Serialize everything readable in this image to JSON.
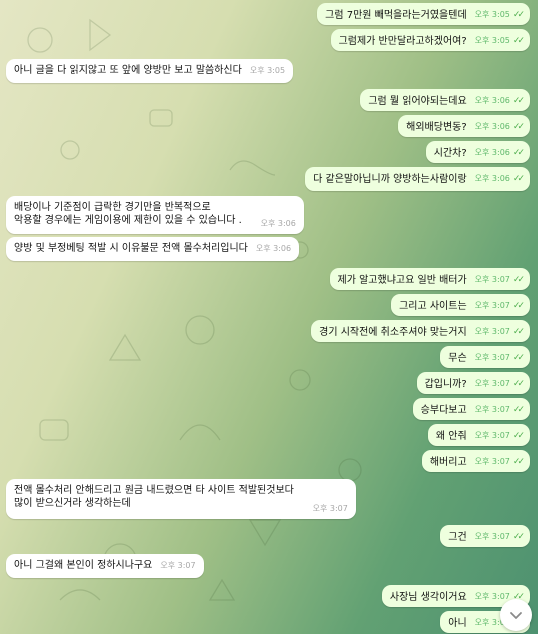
{
  "colors": {
    "outgoing_bubble": "#eeffde",
    "incoming_bubble": "#ffffff",
    "read_check": "#4fae4e"
  },
  "messages": [
    {
      "side": "out",
      "text": "그럼 7만원 빼먹을라는거였을텐데",
      "time": "오후 3:05",
      "read": true
    },
    {
      "side": "out",
      "text": "그럼제가 반만달라고하겠어여?",
      "time": "오후 3:05",
      "read": true
    },
    {
      "side": "in",
      "text": "아니 글을 다 읽지않고 또 앞에 양방만 보고 말씀하신다",
      "time": "오후 3:05"
    },
    {
      "side": "out",
      "text": "그럼 뭘 읽어야되는데요",
      "time": "오후 3:06",
      "read": true
    },
    {
      "side": "out",
      "text": "해외배당변동?",
      "time": "오후 3:06",
      "read": true
    },
    {
      "side": "out",
      "text": "시간차?",
      "time": "오후 3:06",
      "read": true
    },
    {
      "side": "out",
      "text": "다 같은말아닙니까 양방하는사람이랑",
      "time": "오후 3:06",
      "read": true
    },
    {
      "side": "in",
      "text": "배당이나 기준점이 급락한 경기만을 반복적으로\n악용할 경우에는 게임이용에 제한이 있을 수 있습니다 .",
      "time": "오후 3:06"
    },
    {
      "side": "in",
      "text": "양방 및 부정베팅 적발 시 이유불문 전액 몰수처리입니다",
      "time": "오후 3:06"
    },
    {
      "side": "out",
      "text": "제가 알고했냐고요 일반 배터가",
      "time": "오후 3:07",
      "read": true
    },
    {
      "side": "out",
      "text": "그리고 사이트는",
      "time": "오후 3:07",
      "read": true
    },
    {
      "side": "out",
      "text": "경기 시작전에 취소주셔야 맞는거지",
      "time": "오후 3:07",
      "read": true
    },
    {
      "side": "out",
      "text": "무슨",
      "time": "오후 3:07",
      "read": true
    },
    {
      "side": "out",
      "text": "갑입니까?",
      "time": "오후 3:07",
      "read": true
    },
    {
      "side": "out",
      "text": "승부다보고",
      "time": "오후 3:07",
      "read": true
    },
    {
      "side": "out",
      "text": "왜 안줘",
      "time": "오후 3:07",
      "read": true
    },
    {
      "side": "out",
      "text": "해버리고",
      "time": "오후 3:07",
      "read": true
    },
    {
      "side": "in",
      "text": "전액 몰수처리 안해드리고 원금 내드렸으면 타 사이트 적발된것보다\n많이 받으신거라 생각하는데",
      "time": "오후 3:07"
    },
    {
      "side": "out",
      "text": "그건",
      "time": "오후 3:07",
      "read": true
    },
    {
      "side": "in",
      "text": "아니 그걸왜 본인이 정하시나구요",
      "time": "오후 3:07"
    },
    {
      "side": "out",
      "text": "사장님 생각이거요",
      "time": "오후 3:07",
      "read": true
    },
    {
      "side": "out",
      "text": "아니",
      "time": "오후 3:07",
      "read": true
    }
  ],
  "scroll_button": {
    "icon": "chevron-down-icon"
  }
}
